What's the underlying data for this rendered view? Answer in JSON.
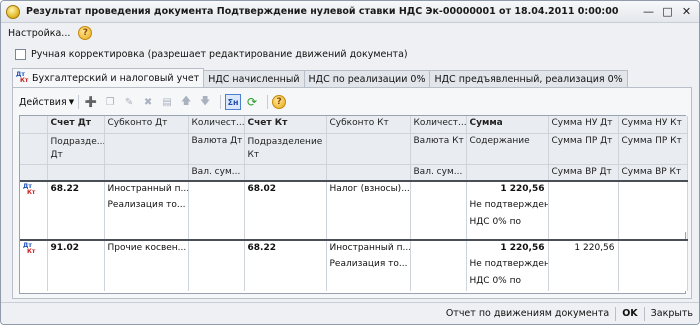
{
  "window": {
    "title": "Результат проведения документа Подтверждение нулевой ставки НДС Эк-00000001 от 18.04.2011 0:00:00"
  },
  "menu": {
    "settings": "Настройка..."
  },
  "checkbox": {
    "label": "Ручная корректировка (разрешает редактирование движений документа)",
    "checked": false
  },
  "tabs": [
    {
      "label": "Бухгалтерский и налоговый учет",
      "active": true
    },
    {
      "label": "НДС начисленный",
      "active": false
    },
    {
      "label": "НДС по реализации 0%",
      "active": false
    },
    {
      "label": "НДС предъявленный, реализация 0%",
      "active": false
    }
  ],
  "toolbar": {
    "actions": "Действия",
    "sum_label": "Σн"
  },
  "icon": {
    "dt": "Дт",
    "kt": "Кт"
  },
  "table": {
    "header": {
      "schet_dt": "Счет Дт",
      "subkonto_dt": "Субконто Дт",
      "kolich1": "Количест...",
      "schet_kt": "Счет Кт",
      "subkonto_kt": "Субконто Кт",
      "kolich2": "Количест...",
      "summa": "Сумма",
      "summa_nu_dt": "Сумма НУ Дт",
      "summa_nu_kt": "Сумма НУ Кт",
      "podrazd_dt": "Подразде...",
      "dt": "Дт",
      "valuta_dt": "Валюта Дт",
      "podrazd_kt": "Подразделение",
      "kt": "Кт",
      "valuta_kt": "Валюта Кт",
      "soderzhanie": "Содержание",
      "summa_pr_dt": "Сумма ПР Дт",
      "summa_pr_kt": "Сумма ПР Кт",
      "val_sum1": "Вал. сум...",
      "val_sum2": "Вал. сум...",
      "summa_vr_dt": "Сумма ВР Дт",
      "summa_vr_kt": "Сумма ВР Кт"
    },
    "rows": [
      {
        "schet_dt": "68.22",
        "sub_dt_1": "Иностранный п...",
        "sub_dt_2": "Реализация то...",
        "schet_kt": "68.02",
        "sub_kt_1": "Налог (взносы)...",
        "sub_kt_2": "",
        "summa": "1 220,56",
        "content_1": "Не подтвержден",
        "content_2": "НДС 0% по",
        "nu_dt": "",
        "nu_kt": ""
      },
      {
        "schet_dt": "91.02",
        "sub_dt_1": "Прочие косвен...",
        "sub_dt_2": "",
        "schet_kt": "68.22",
        "sub_kt_1": "Иностранный п...",
        "sub_kt_2": "Реализация то...",
        "summa": "1 220,56",
        "content_1": "Не подтвержден",
        "content_2": "НДС 0% по",
        "nu_dt": "1 220,56",
        "nu_kt": ""
      }
    ]
  },
  "footer": {
    "report": "Отчет по движениям документа",
    "ok": "OK",
    "close": "Закрыть"
  }
}
